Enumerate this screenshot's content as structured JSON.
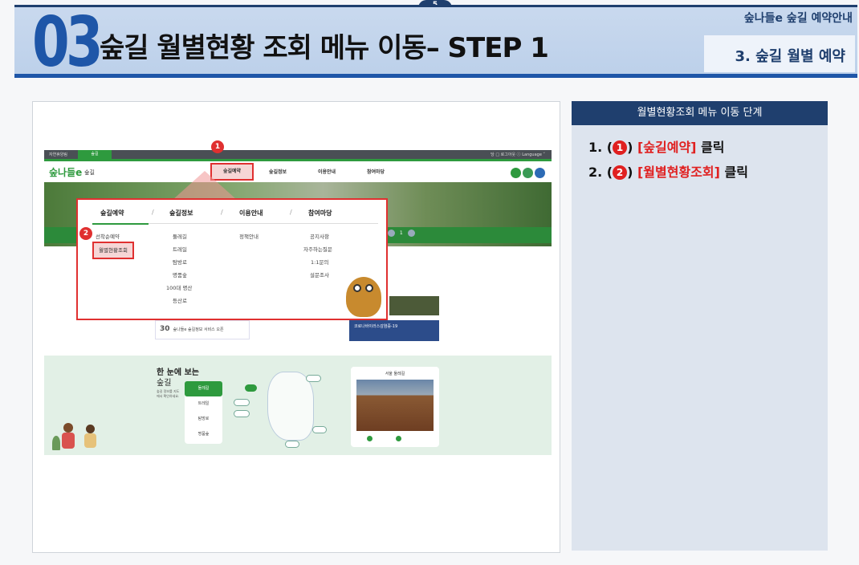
{
  "header": {
    "page_number": "5",
    "section_number": "03",
    "title": "숲길 월별현황 조회 메뉴 이동– STEP 1",
    "breadcrumb_top": "숲나들e 숲길 예약안내",
    "breadcrumb_sub": "3. 숲길 월별 예약"
  },
  "screenshot": {
    "topbar": {
      "left_label": "자연휴양림",
      "green_tab": "숲길",
      "right_label": "당  □ 로그아웃  ⓛ Language ˅"
    },
    "logo": "숲나들e",
    "logo_sub": "숲길",
    "nav": [
      "숲길예약",
      "숲길정보",
      "이용안내",
      "참여마당"
    ],
    "active_nav_index": 0,
    "mega_menu": {
      "tabs": [
        "숲길예약",
        "숲길정보",
        "이용안내",
        "참여마당"
      ],
      "columns": [
        [
          "선착순예약",
          "월별현황조회"
        ],
        [
          "둘레길",
          "트레일",
          "탐방로",
          "명품숲",
          "100대 명산",
          "등산로"
        ],
        [
          "정책안내"
        ],
        [
          "공지사항",
          "자주하는질문",
          "1:1문의",
          "설문조사"
        ]
      ],
      "highlighted_item": "월별현황조회"
    },
    "pager": "1",
    "notice": {
      "day": "30",
      "text": "숲나들e 숲길정보 서비스 오픈"
    },
    "banner_text": "코로나바이러스감염증-19",
    "map_section": {
      "title_line1": "한 눈에 보는",
      "title_line2": "숲길",
      "desc": "숲길 정보를 지도에서 확인하세요.",
      "menu": [
        "둘레길",
        "트레일",
        "탐방로",
        "명품숲"
      ],
      "active_menu": "둘레길",
      "card_title": "서울 둘레길"
    },
    "badges": [
      "1",
      "2"
    ]
  },
  "panel": {
    "heading": "월별현황조회 메뉴 이동 단계",
    "steps": [
      {
        "prefix": "1. (",
        "badge": "1",
        "close": ") ",
        "target": "[숲길예약]",
        "suffix": " 클릭"
      },
      {
        "prefix": "2. (",
        "badge": "2",
        "close": ") ",
        "target": "[월별현황조회]",
        "suffix": " 클릭"
      }
    ]
  },
  "colors": {
    "navy": "#1f3f6e",
    "blue": "#1e56a8",
    "highlight_red": "#e03030",
    "site_green": "#2e9a3e",
    "panel_bg": "#dde4ee"
  }
}
